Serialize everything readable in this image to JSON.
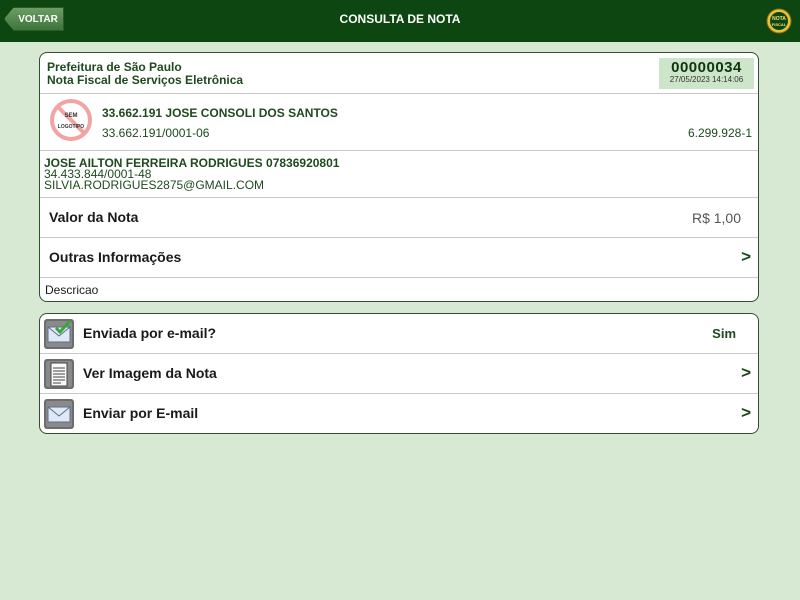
{
  "header": {
    "back_label": "VOLTAR",
    "title": "CONSULTA DE NOTA",
    "logo_text": "NOTA FISCAL PAULISTA"
  },
  "nota": {
    "prefeitura": "Prefeitura de São Paulo",
    "subtitulo": "Nota Fiscal de Serviços Eletrônica",
    "numero": "00000034",
    "data_hora": "27/05/2023 14:14:06"
  },
  "prestador": {
    "logo_placeholder": "SEM LOGOTIPO",
    "nome": "33.662.191 JOSE CONSOLI DOS SANTOS",
    "cnpj": "33.662.191/0001-06",
    "inscricao": "6.299.928-1"
  },
  "tomador": {
    "nome": "JOSE AILTON FERREIRA RODRIGUES 07836920801",
    "documento": "34.433.844/0001-48",
    "email": "SILVIA.RODRIGUES2875@GMAIL.COM"
  },
  "valor": {
    "label": "Valor da Nota",
    "value": "R$ 1,00"
  },
  "outras": {
    "label": "Outras Informações",
    "chevron": ">"
  },
  "descricao": "Descricao",
  "acoes": [
    {
      "label": "Enviada por e-mail?",
      "value": "Sim",
      "icon": "mail-sent-icon"
    },
    {
      "label": "Ver Imagem da Nota",
      "chevron": ">",
      "icon": "document-icon"
    },
    {
      "label": "Enviar por E-mail",
      "chevron": ">",
      "icon": "mail-icon"
    }
  ],
  "colors": {
    "header_bg": "#0d4610",
    "page_bg": "#d7e9d2",
    "accent_green": "#1e4a1e",
    "number_box": "#cde5c8"
  }
}
